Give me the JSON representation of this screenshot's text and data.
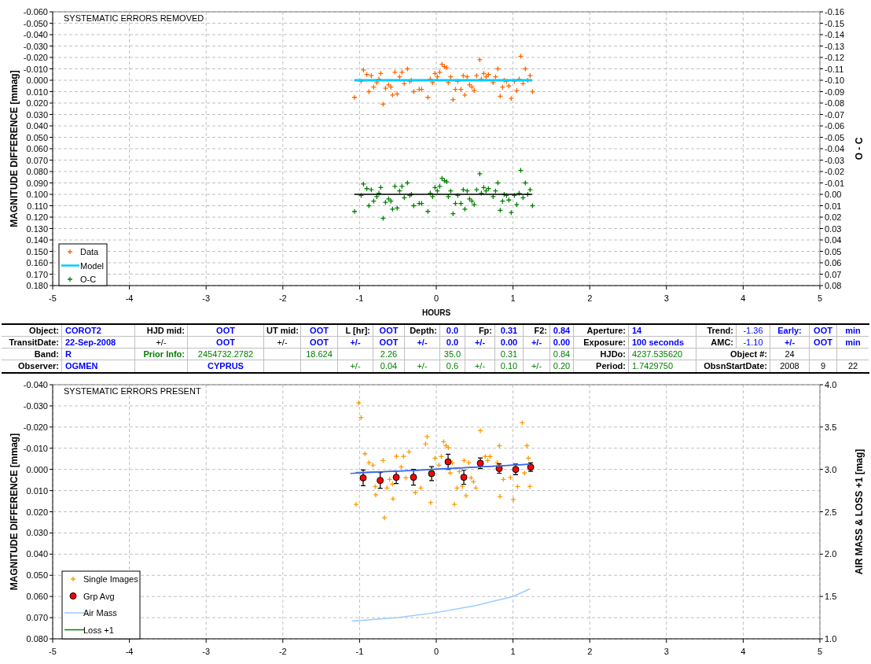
{
  "charts": [
    {
      "chart_data": {
        "type": "scatter",
        "title": "SYSTEMATIC ERRORS REMOVED",
        "xlabel": "HOURS",
        "ylabel": "MAGNITUDE DIFFERENCE [mmag]",
        "y2label": "O - C",
        "grid": true,
        "legend": "lower left",
        "xlim": [
          -5,
          5
        ],
        "ylim": [
          0.18,
          -0.06
        ],
        "y2lim": [
          0.08,
          -0.16
        ],
        "xticks": [
          {
            "value": -5,
            "label": "-5"
          },
          {
            "value": -4,
            "label": "-4"
          },
          {
            "value": -3,
            "label": "-3"
          },
          {
            "value": -2,
            "label": "-2"
          },
          {
            "value": -1,
            "label": "-1"
          },
          {
            "value": 0,
            "label": "0"
          },
          {
            "value": 1,
            "label": "1"
          },
          {
            "value": 2,
            "label": "2"
          },
          {
            "value": 3,
            "label": "3"
          },
          {
            "value": 4,
            "label": "4"
          },
          {
            "value": 5,
            "label": "5"
          }
        ],
        "yticks": [
          {
            "value": -0.06,
            "label": "-0.060"
          },
          {
            "value": -0.05,
            "label": "-0.050"
          },
          {
            "value": -0.04,
            "label": "-0.040"
          },
          {
            "value": -0.03,
            "label": "-0.030"
          },
          {
            "value": -0.02,
            "label": "-0.020"
          },
          {
            "value": -0.01,
            "label": "-0.010"
          },
          {
            "value": 0,
            "label": "0.000"
          },
          {
            "value": 0.01,
            "label": "0.010"
          },
          {
            "value": 0.02,
            "label": "0.020"
          },
          {
            "value": 0.03,
            "label": "0.030"
          },
          {
            "value": 0.04,
            "label": "0.040"
          },
          {
            "value": 0.05,
            "label": "0.050"
          },
          {
            "value": 0.06,
            "label": "0.060"
          },
          {
            "value": 0.07,
            "label": "0.070"
          },
          {
            "value": 0.08,
            "label": "0.080"
          },
          {
            "value": 0.09,
            "label": "0.090"
          },
          {
            "value": 0.1,
            "label": "0.100"
          },
          {
            "value": 0.11,
            "label": "0.110"
          },
          {
            "value": 0.12,
            "label": "0.120"
          },
          {
            "value": 0.13,
            "label": "0.130"
          },
          {
            "value": 0.14,
            "label": "0.140"
          },
          {
            "value": 0.15,
            "label": "0.150"
          },
          {
            "value": 0.16,
            "label": "0.160"
          },
          {
            "value": 0.17,
            "label": "0.170"
          },
          {
            "value": 0.18,
            "label": "0.180"
          }
        ],
        "y2ticks": [
          {
            "value": -0.16,
            "label": "-0.16"
          },
          {
            "value": -0.15,
            "label": "-0.15"
          },
          {
            "value": -0.14,
            "label": "-0.14"
          },
          {
            "value": -0.13,
            "label": "-0.13"
          },
          {
            "value": -0.12,
            "label": "-0.12"
          },
          {
            "value": -0.11,
            "label": "-0.11"
          },
          {
            "value": -0.1,
            "label": "-0.10"
          },
          {
            "value": -0.09,
            "label": "-0.09"
          },
          {
            "value": -0.08,
            "label": "-0.08"
          },
          {
            "value": -0.07,
            "label": "-0.07"
          },
          {
            "value": -0.06,
            "label": "-0.06"
          },
          {
            "value": -0.05,
            "label": "-0.05"
          },
          {
            "value": -0.04,
            "label": "-0.04"
          },
          {
            "value": -0.03,
            "label": "-0.03"
          },
          {
            "value": -0.02,
            "label": "-0.02"
          },
          {
            "value": -0.01,
            "label": "-0.01"
          },
          {
            "value": 0,
            "label": "0.00"
          },
          {
            "value": 0.01,
            "label": "0.01"
          },
          {
            "value": 0.02,
            "label": "0.02"
          },
          {
            "value": 0.03,
            "label": "0.03"
          },
          {
            "value": 0.04,
            "label": "0.04"
          },
          {
            "value": 0.05,
            "label": "0.05"
          },
          {
            "value": 0.06,
            "label": "0.06"
          },
          {
            "value": 0.07,
            "label": "0.07"
          },
          {
            "value": 0.08,
            "label": "0.08"
          }
        ],
        "series": [
          {
            "name": "Data",
            "type": "scatter",
            "color": "#ff6600",
            "x": [
              -1.065,
              -0.98,
              -0.949,
              -0.905,
              -0.878,
              -0.847,
              -0.816,
              -0.775,
              -0.748,
              -0.724,
              -0.693,
              -0.662,
              -0.621,
              -0.591,
              -0.57,
              -0.539,
              -0.509,
              -0.478,
              -0.447,
              -0.417,
              -0.376,
              -0.345,
              -0.324,
              -0.294,
              -0.222,
              -0.191,
              -0.109,
              -0.078,
              -0.048,
              -0.017,
              0.014,
              0.045,
              0.075,
              0.106,
              0.137,
              0.157,
              0.188,
              0.219,
              0.25,
              0.28,
              0.321,
              0.352,
              0.373,
              0.403,
              0.434,
              0.465,
              0.495,
              0.526,
              0.567,
              0.588,
              0.618,
              0.649,
              0.68,
              0.741,
              0.772,
              0.803,
              0.833,
              0.864,
              0.885,
              0.915,
              0.946,
              0.977,
              1.018,
              1.049,
              1.08,
              1.1,
              1.131,
              1.161,
              1.192,
              1.223,
              1.254
            ],
            "values": [
              0.015,
              0.001,
              -0.009,
              -0.005,
              0.01,
              -0.004,
              0.006,
              0.002,
              -0.001,
              -0.006,
              0.021,
              0.007,
              0.004,
              0.006,
              0.013,
              -0.007,
              0.012,
              -0.003,
              -0.007,
              0.003,
              -0.01,
              0.001,
              0,
              0.01,
              0.008,
              0.008,
              0.015,
              -0.001,
              0.002,
              -0.006,
              -0.003,
              -0.007,
              -0.014,
              -0.012,
              -0.011,
              0.002,
              -0.003,
              0.017,
              0.008,
              0.001,
              0.008,
              -0.004,
              0.013,
              -0.003,
              0.004,
              0.006,
              0.009,
              -0.004,
              -0.018,
              -0.001,
              -0.006,
              -0.003,
              -0.005,
              0.002,
              -0.003,
              -0.01,
              0.014,
              0.006,
              0,
              0.001,
              0.005,
              0.016,
              0.001,
              0.009,
              -0.001,
              -0.021,
              0.003,
              -0.01,
              0,
              -0.004,
              0.01
            ]
          },
          {
            "name": "Model",
            "type": "line",
            "color": "#00ccff",
            "x": [
              -1.07,
              1.25
            ],
            "values": [
              0,
              0
            ]
          },
          {
            "name": "O-C",
            "type": "scatter",
            "color": "#008000",
            "axis": "y2",
            "x": [
              -1.065,
              -0.98,
              -0.949,
              -0.905,
              -0.878,
              -0.847,
              -0.816,
              -0.775,
              -0.748,
              -0.724,
              -0.693,
              -0.662,
              -0.621,
              -0.591,
              -0.57,
              -0.539,
              -0.509,
              -0.478,
              -0.447,
              -0.417,
              -0.376,
              -0.345,
              -0.324,
              -0.294,
              -0.222,
              -0.191,
              -0.109,
              -0.078,
              -0.048,
              -0.017,
              0.014,
              0.045,
              0.075,
              0.106,
              0.137,
              0.157,
              0.188,
              0.219,
              0.25,
              0.28,
              0.321,
              0.352,
              0.373,
              0.403,
              0.434,
              0.465,
              0.495,
              0.526,
              0.567,
              0.588,
              0.618,
              0.649,
              0.68,
              0.741,
              0.772,
              0.803,
              0.833,
              0.864,
              0.885,
              0.915,
              0.946,
              0.977,
              1.018,
              1.049,
              1.08,
              1.1,
              1.131,
              1.161,
              1.192,
              1.223,
              1.254
            ],
            "values": [
              0.015,
              0.001,
              -0.009,
              -0.005,
              0.01,
              -0.004,
              0.006,
              0.002,
              -0.001,
              -0.006,
              0.021,
              0.007,
              0.004,
              0.006,
              0.013,
              -0.007,
              0.012,
              -0.003,
              -0.007,
              0.003,
              -0.01,
              0.001,
              0,
              0.01,
              0.008,
              0.008,
              0.015,
              -0.001,
              0.002,
              -0.006,
              -0.003,
              -0.007,
              -0.014,
              -0.012,
              -0.011,
              0.002,
              -0.003,
              0.017,
              0.008,
              0.001,
              0.008,
              -0.004,
              0.013,
              -0.003,
              0.004,
              0.006,
              0.009,
              -0.004,
              -0.018,
              -0.001,
              -0.006,
              -0.003,
              -0.005,
              0.002,
              -0.003,
              -0.01,
              0.014,
              0.006,
              0,
              0.001,
              0.005,
              0.016,
              0.001,
              0.009,
              -0.001,
              -0.021,
              0.003,
              -0.01,
              0,
              -0.004,
              0.01
            ]
          },
          {
            "type": "line",
            "color": "#000000",
            "axis": "y2",
            "x": [
              -1.07,
              1.25
            ],
            "values": [
              0,
              0
            ]
          }
        ]
      }
    },
    {
      "chart_data": {
        "type": "scatter",
        "title": "SYSTEMATIC ERRORS PRESENT",
        "ylabel": "MAGNITUDE DIFFERENCE [mmag]",
        "y2label": "AIR MASS & LOSS +1 [mag]",
        "grid": true,
        "legend": "lower left",
        "xlim": [
          -5,
          5
        ],
        "ylim": [
          0.08,
          -0.04
        ],
        "y2lim": [
          1,
          4
        ],
        "xticks": [
          {
            "value": -5,
            "label": "-5"
          },
          {
            "value": -4,
            "label": "-4"
          },
          {
            "value": -3,
            "label": "-3"
          },
          {
            "value": -2,
            "label": "-2"
          },
          {
            "value": -1,
            "label": "-1"
          },
          {
            "value": 0,
            "label": "0"
          },
          {
            "value": 1,
            "label": "1"
          },
          {
            "value": 2,
            "label": "2"
          },
          {
            "value": 3,
            "label": "3"
          },
          {
            "value": 4,
            "label": "4"
          },
          {
            "value": 5,
            "label": "5"
          }
        ],
        "yticks": [
          {
            "value": -0.04,
            "label": "-0.040"
          },
          {
            "value": -0.03,
            "label": "-0.030"
          },
          {
            "value": -0.02,
            "label": "-0.020"
          },
          {
            "value": -0.01,
            "label": "-0.010"
          },
          {
            "value": 0,
            "label": "0.000"
          },
          {
            "value": 0.01,
            "label": "0.010"
          },
          {
            "value": 0.02,
            "label": "0.020"
          },
          {
            "value": 0.03,
            "label": "0.030"
          },
          {
            "value": 0.04,
            "label": "0.040"
          },
          {
            "value": 0.05,
            "label": "0.050"
          },
          {
            "value": 0.06,
            "label": "0.060"
          },
          {
            "value": 0.07,
            "label": "0.070"
          },
          {
            "value": 0.08,
            "label": "0.080"
          }
        ],
        "y2ticks": [
          {
            "value": 1,
            "label": "1.0"
          },
          {
            "value": 1.5,
            "label": "1.5"
          },
          {
            "value": 2,
            "label": "2.0"
          },
          {
            "value": 2.5,
            "label": "2.5"
          },
          {
            "value": 3,
            "label": "3.0"
          },
          {
            "value": 3.5,
            "label": "3.5"
          },
          {
            "value": 4,
            "label": "4.0"
          }
        ],
        "series": [
          {
            "name": "Single Images",
            "type": "scatter",
            "color": "#ff9900",
            "x": [
              -1.011,
              -0.98,
              -0.929,
              -0.878,
              -0.826,
              -0.693,
              -0.519,
              -0.457,
              -0.427,
              -0.355,
              -0.14,
              -0.119,
              -0.017,
              0.034,
              0.065,
              0.096,
              0.127,
              0.157,
              0.208,
              0.181,
              0.301,
              0.362,
              0.424,
              0.454,
              0.485,
              0.516,
              0.574,
              0.639,
              0.67,
              0.7,
              0.793,
              0.823,
              0.875,
              0.967,
              1.059,
              1.12,
              1.151,
              1.182,
              1.2,
              1.22,
              0.27,
              0.342,
              -0.796,
              -0.642,
              -0.57,
              -0.201,
              -0.273,
              -0.608,
              -0.396,
              -1.045,
              -0.676,
              -0.789,
              -0.564,
              -0.072,
              0.236,
              0.389,
              0.83,
              1.004
            ],
            "values": [
              -0.0314,
              -0.0245,
              -0.0074,
              -0.0032,
              -0.002,
              -0.0042,
              -0.0062,
              -0.0012,
              -0.0062,
              -0.0083,
              -0.012,
              -0.0154,
              -0.0053,
              -0.002,
              -0.0061,
              -0.0131,
              -0.0112,
              -0.0103,
              -0.0031,
              0.0017,
              0.001,
              -0.0042,
              -0.0032,
              0.004,
              0.0058,
              0.0088,
              -0.0183,
              -0.0061,
              -0.0042,
              -0.0061,
              -0.0032,
              -0.0112,
              0.0047,
              0.0038,
              0.0081,
              -0.022,
              0.0017,
              -0.0112,
              -0.0053,
              0.0081,
              0.0088,
              0.0079,
              0.0081,
              0.0088,
              0.0069,
              0.0088,
              0.0109,
              0.0047,
              0.004,
              0.0165,
              0.0228,
              0.012,
              0.0139,
              0.0157,
              0.0165,
              0.0124,
              0.0128,
              0.0142
            ]
          },
          {
            "name": "Grp Avg",
            "type": "scatter",
            "color": "#ff0000",
            "x": [
              -0.953,
              -0.731,
              -0.522,
              -0.297,
              -0.061,
              0.154,
              0.359,
              0.574,
              0.82,
              1.035,
              1.23
            ],
            "values": [
              0.004,
              0.0052,
              0.0037,
              0.0037,
              0.002,
              -0.0036,
              0.0037,
              -0.0029,
              -0.0004,
              0,
              -0.0011
            ],
            "errors": [
              0.0037,
              0.0037,
              0.003,
              0.0037,
              0.0033,
              0.0036,
              0.0033,
              0.0025,
              0.0022,
              0.0025,
              0.002
            ]
          },
          {
            "name": "Air Mass",
            "type": "line",
            "color": "#99ccff",
            "axis": "y2",
            "x": [
              -1.1,
              -0.5,
              0,
              0.5,
              1.0,
              1.22
            ],
            "values": [
              1.21,
              1.25,
              1.31,
              1.39,
              1.5,
              1.59
            ]
          },
          {
            "name": "Loss +1",
            "type": "line",
            "color": "#008000",
            "axis": "y2"
          },
          {
            "type": "line",
            "color": "#808080",
            "x": [
              -1.05,
              -0.3,
              0.3,
              1.2
            ],
            "values": [
              0.0014,
              0.0006,
              -0.0006,
              -0.0024
            ]
          },
          {
            "type": "line",
            "color": "#3366ff",
            "x": [
              -1.12,
              -0.6,
              0,
              0.6,
              1.22
            ],
            "values": [
              0.0019,
              0.001,
              -0.0002,
              -0.0013,
              -0.0025
            ]
          }
        ]
      }
    }
  ],
  "table": {
    "rows": [
      [
        {
          "text": "Object:",
          "kind": "label"
        },
        {
          "text": "COROT2",
          "kind": "value"
        },
        {
          "text": "HJD mid:",
          "kind": "label"
        },
        {
          "text": "OOT",
          "kind": "value"
        },
        {
          "text": "UT mid:",
          "kind": "label"
        },
        {
          "text": "OOT",
          "kind": "value"
        },
        {
          "text": "L [hr]:",
          "kind": "label"
        },
        {
          "text": "OOT",
          "kind": "value"
        },
        {
          "text": "Depth:",
          "kind": "label"
        },
        {
          "text": "0.0",
          "kind": "value"
        },
        {
          "text": "Fp:",
          "kind": "label"
        },
        {
          "text": "0.31",
          "kind": "value"
        },
        {
          "text": "F2:",
          "kind": "label"
        },
        {
          "text": "0.84",
          "kind": "value"
        },
        {
          "text": "Aperture:",
          "kind": "label"
        },
        {
          "text": "14",
          "kind": "value"
        },
        {
          "text": "Trend:",
          "kind": "label"
        },
        {
          "text": "-1.36",
          "kind": "reading"
        },
        {
          "text": "Early:",
          "kind": "value"
        },
        {
          "text": "OOT",
          "kind": "value"
        },
        {
          "text": "min",
          "kind": "value"
        }
      ],
      [
        {
          "text": "TransitDate:",
          "kind": "label"
        },
        {
          "text": "22-Sep-2008",
          "kind": "value"
        },
        {
          "text": "+/-",
          "kind": "plain"
        },
        {
          "text": "OOT",
          "kind": "value"
        },
        {
          "text": "+/-",
          "kind": "plain"
        },
        {
          "text": "OOT",
          "kind": "value"
        },
        {
          "text": "+/-",
          "kind": "value"
        },
        {
          "text": "OOT",
          "kind": "value"
        },
        {
          "text": "+/-",
          "kind": "value"
        },
        {
          "text": "0.0",
          "kind": "value"
        },
        {
          "text": "+/-",
          "kind": "value"
        },
        {
          "text": "0.00",
          "kind": "value"
        },
        {
          "text": "+/-",
          "kind": "value"
        },
        {
          "text": "0.00",
          "kind": "value"
        },
        {
          "text": "Exposure:",
          "kind": "label"
        },
        {
          "text": "100 seconds",
          "kind": "value"
        },
        {
          "text": "AMC:",
          "kind": "label"
        },
        {
          "text": "-1.10",
          "kind": "reading"
        },
        {
          "text": "+/-",
          "kind": "value"
        },
        {
          "text": "OOT",
          "kind": "value"
        },
        {
          "text": "min",
          "kind": "value"
        }
      ],
      [
        {
          "text": "Band:",
          "kind": "label"
        },
        {
          "text": "R",
          "kind": "value"
        },
        {
          "text": "Prior Info:",
          "kind": "note-label"
        },
        {
          "text": "2454732.2782",
          "kind": "note"
        },
        {
          "kind": "empty"
        },
        {
          "text": "18.624",
          "kind": "note"
        },
        {
          "kind": "empty"
        },
        {
          "text": "2.26",
          "kind": "note"
        },
        {
          "kind": "empty"
        },
        {
          "text": "35.0",
          "kind": "note"
        },
        {
          "kind": "empty"
        },
        {
          "text": "0.31",
          "kind": "note"
        },
        {
          "kind": "empty"
        },
        {
          "text": "0.84",
          "kind": "note"
        },
        {
          "text": "HJDo:",
          "kind": "label"
        },
        {
          "text": "4237.535620",
          "kind": "note"
        },
        {
          "text": "Object #:",
          "kind": "label"
        },
        {
          "kind": "empty"
        },
        {
          "text": "24",
          "kind": "plain"
        },
        {
          "kind": "empty"
        },
        {
          "kind": "empty"
        }
      ],
      [
        {
          "text": "Observer:",
          "kind": "label"
        },
        {
          "text": "OGMEN",
          "kind": "value"
        },
        {
          "kind": "empty"
        },
        {
          "text": "CYPRUS",
          "kind": "value"
        },
        {
          "kind": "empty"
        },
        {
          "kind": "empty"
        },
        {
          "text": "+/-",
          "kind": "note"
        },
        {
          "text": "0.04",
          "kind": "note"
        },
        {
          "text": "+/-",
          "kind": "note"
        },
        {
          "text": "0.6",
          "kind": "note"
        },
        {
          "text": "+/-",
          "kind": "note"
        },
        {
          "text": "0.10",
          "kind": "note"
        },
        {
          "text": "+/-",
          "kind": "note"
        },
        {
          "text": "0.20",
          "kind": "note"
        },
        {
          "text": "Period:",
          "kind": "label"
        },
        {
          "text": "1.7429750",
          "kind": "note"
        },
        {
          "text": "ObsnStartDate:",
          "kind": "label"
        },
        {
          "kind": "empty"
        },
        {
          "text": "2008",
          "kind": "plain"
        },
        {
          "text": "9",
          "kind": "plain"
        },
        {
          "text": "22",
          "kind": "plain"
        }
      ]
    ]
  }
}
